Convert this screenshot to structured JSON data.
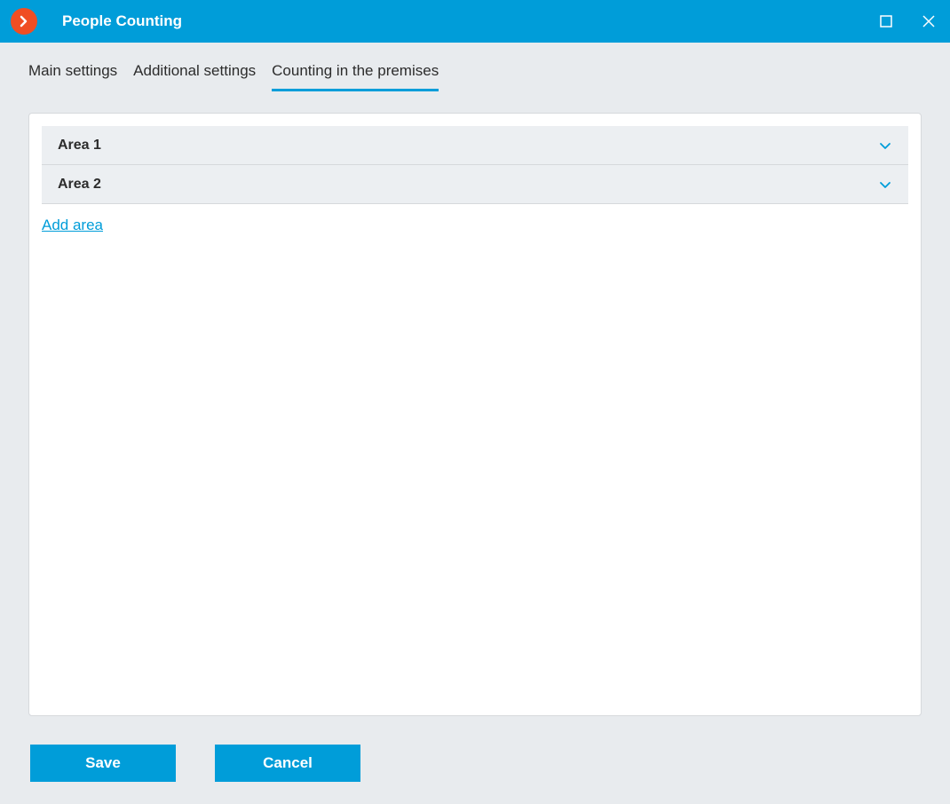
{
  "header": {
    "title": "People Counting"
  },
  "tabs": {
    "main": "Main settings",
    "additional": "Additional settings",
    "counting": "Counting in the premises"
  },
  "areas": {
    "0": {
      "label": "Area 1"
    },
    "1": {
      "label": "Area 2"
    }
  },
  "actions": {
    "add_area": "Add area"
  },
  "footer": {
    "save": "Save",
    "cancel": "Cancel"
  }
}
